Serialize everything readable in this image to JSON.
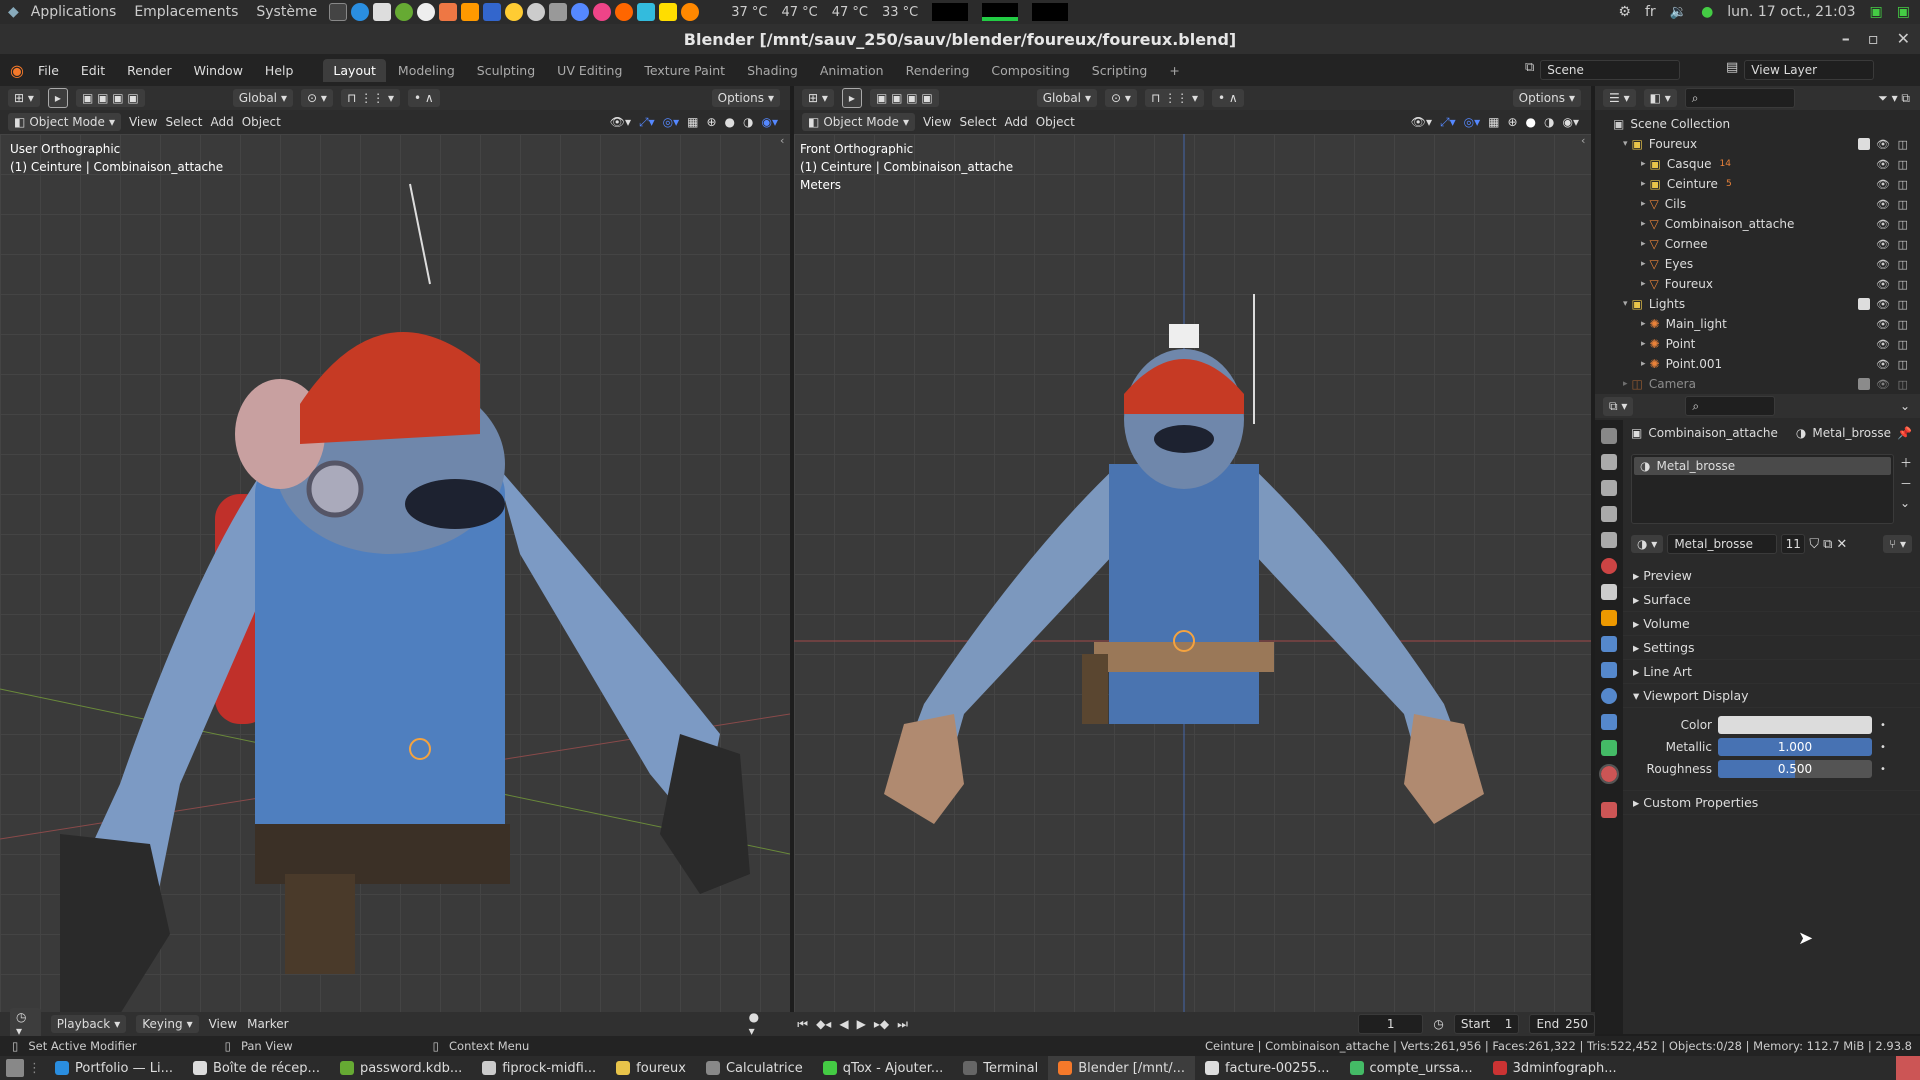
{
  "os_panel": {
    "menus": [
      "Applications",
      "Emplacements",
      "Système"
    ],
    "temps": [
      "37 °C",
      "47 °C",
      "47 °C",
      "33 °C"
    ],
    "lang": "fr",
    "datetime": "lun. 17 oct., 21:03"
  },
  "window": {
    "title": "Blender [/mnt/sauv_250/sauv/blender/foureux/foureux.blend]"
  },
  "topbar": {
    "menus": [
      "File",
      "Edit",
      "Render",
      "Window",
      "Help"
    ],
    "tabs": [
      "Layout",
      "Modeling",
      "Sculpting",
      "UV Editing",
      "Texture Paint",
      "Shading",
      "Animation",
      "Rendering",
      "Compositing",
      "Scripting"
    ],
    "active_tab": "Layout",
    "scene": "Scene",
    "view_layer": "View Layer"
  },
  "viewport_left": {
    "transform": "Global",
    "options": "Options",
    "mode": "Object Mode",
    "menus": [
      "View",
      "Select",
      "Add",
      "Object"
    ],
    "overlay_line1": "User Orthographic",
    "overlay_line2": "(1) Ceinture | Combinaison_attache"
  },
  "viewport_right": {
    "transform": "Global",
    "options": "Options",
    "mode": "Object Mode",
    "menus": [
      "View",
      "Select",
      "Add",
      "Object"
    ],
    "overlay_line1": "Front Orthographic",
    "overlay_line2": "(1) Ceinture | Combinaison_attache",
    "overlay_line3": "Meters"
  },
  "outliner": {
    "root": "Scene Collection",
    "items": [
      {
        "label": "Foureux",
        "indent": 1,
        "kind": "collection"
      },
      {
        "label": "Casque",
        "indent": 2,
        "kind": "collection",
        "badge": "14"
      },
      {
        "label": "Ceinture",
        "indent": 2,
        "kind": "collection",
        "badge": "5"
      },
      {
        "label": "Cils",
        "indent": 2,
        "kind": "mesh"
      },
      {
        "label": "Combinaison_attache",
        "indent": 2,
        "kind": "mesh"
      },
      {
        "label": "Cornee",
        "indent": 2,
        "kind": "mesh"
      },
      {
        "label": "Eyes",
        "indent": 2,
        "kind": "mesh"
      },
      {
        "label": "Foureux",
        "indent": 2,
        "kind": "mesh"
      },
      {
        "label": "Lights",
        "indent": 1,
        "kind": "collection"
      },
      {
        "label": "Main_light",
        "indent": 2,
        "kind": "light"
      },
      {
        "label": "Point",
        "indent": 2,
        "kind": "light"
      },
      {
        "label": "Point.001",
        "indent": 2,
        "kind": "light"
      },
      {
        "label": "Camera",
        "indent": 1,
        "kind": "camera"
      }
    ]
  },
  "properties": {
    "breadcrumb_object": "Combinaison_attache",
    "breadcrumb_material": "Metal_brosse",
    "slot": "Metal_brosse",
    "material_name": "Metal_brosse",
    "user_count": "11",
    "panels": [
      "Preview",
      "Surface",
      "Volume",
      "Settings",
      "Line Art",
      "Viewport Display"
    ],
    "viewport_display": {
      "color_label": "Color",
      "metallic_label": "Metallic",
      "metallic_value": "1.000",
      "roughness_label": "Roughness",
      "roughness_value": "0.500",
      "roughness_fraction": 0.5
    },
    "custom_props": "Custom Properties"
  },
  "timeline": {
    "menus": [
      "Playback",
      "Keying",
      "View",
      "Marker"
    ],
    "current_frame": "1",
    "start_label": "Start",
    "start": "1",
    "end_label": "End",
    "end": "250"
  },
  "statusbar": {
    "left1": "Set Active Modifier",
    "left2": "Pan View",
    "left3": "Context Menu",
    "right": "Ceinture | Combinaison_attache | Verts:261,956 | Faces:261,322 | Tris:522,452 | Objects:0/28 | Memory: 112.7 MiB | 2.93.8"
  },
  "taskbar": {
    "tasks": [
      "Portfolio — Li...",
      "Boîte de récep...",
      "password.kdb...",
      "fiprock-midfi...",
      "foureux",
      "Calculatrice",
      "qTox - Ajouter...",
      "Terminal",
      "Blender [/mnt/...",
      "facture-00255...",
      "compte_urssa...",
      "3dminfograph..."
    ],
    "active_index": 8
  }
}
